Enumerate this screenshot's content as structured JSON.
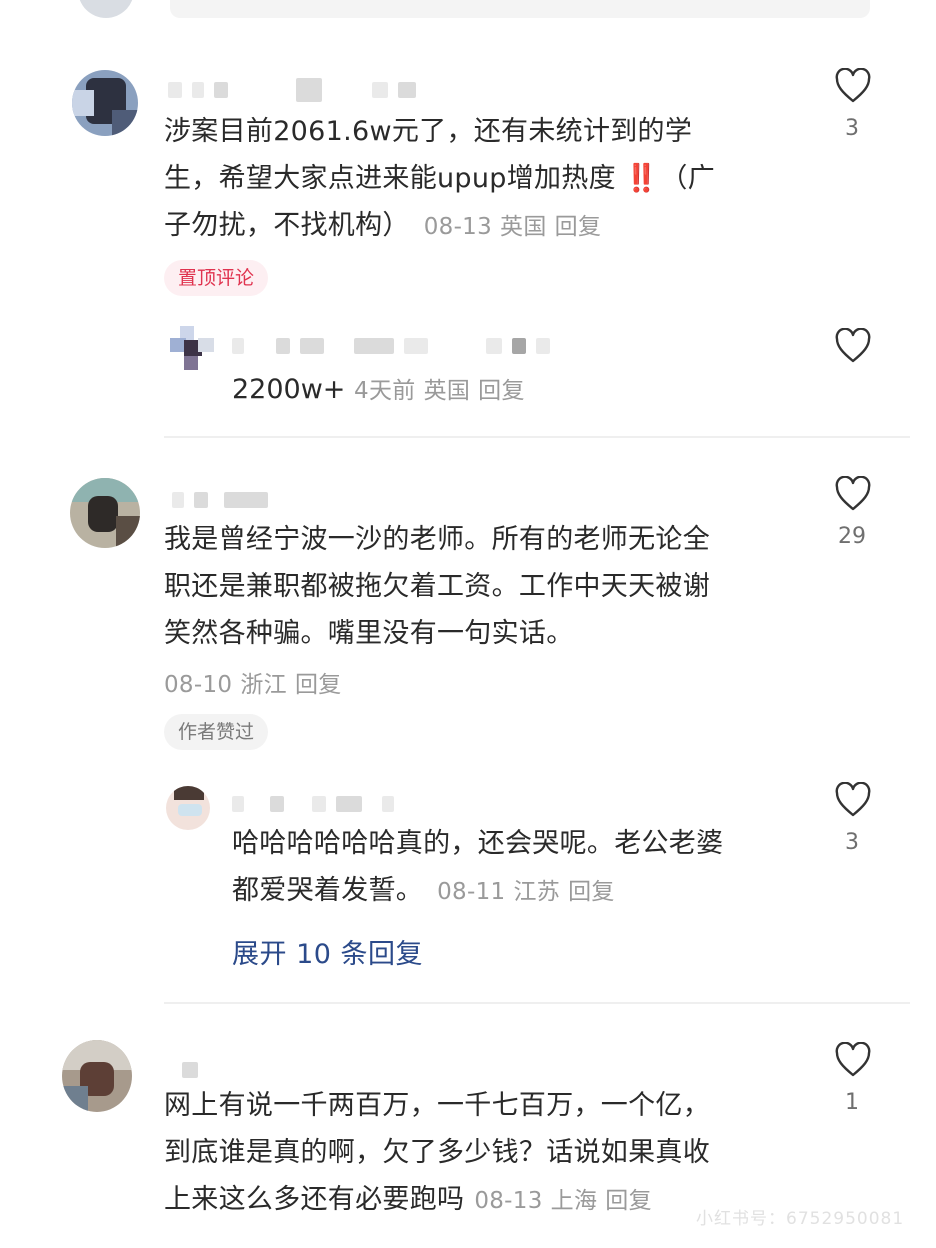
{
  "comments": [
    {
      "text_lines": [
        "涉案目前2061.6w元了，还有未统计到的学",
        "生，希望大家点进来能upup增加热度",
        "子勿扰，不找机构）"
      ],
      "emoji": "‼️",
      "after_emoji": "（广",
      "date": "08-13",
      "location": "英国",
      "reply_label": "回复",
      "badge": "置顶评论",
      "likes": "3",
      "replies": [
        {
          "text": "2200w+",
          "date": "4天前",
          "location": "英国",
          "reply_label": "回复"
        }
      ]
    },
    {
      "text_lines": [
        "我是曾经宁波一沙的老师。所有的老师无论全",
        "职还是兼职都被拖欠着工资。工作中天天被谢",
        "笑然各种骗。嘴里没有一句实话。"
      ],
      "date": "08-10",
      "location": "浙江",
      "reply_label": "回复",
      "badge": "作者赞过",
      "likes": "29",
      "replies": [
        {
          "text_lines": [
            "哈哈哈哈哈哈真的，还会哭呢。老公老婆",
            "都爱哭着发誓。"
          ],
          "date": "08-11",
          "location": "江苏",
          "reply_label": "回复",
          "likes": "3"
        }
      ],
      "expand_label": "展开 10 条回复"
    },
    {
      "text_lines": [
        "网上有说一千两百万，一千七百万，一个亿，",
        "到底谁是真的啊，欠了多少钱？话说如果真收",
        "上来这么多还有必要跑吗"
      ],
      "date": "08-13",
      "location": "上海",
      "reply_label": "回复",
      "likes": "1"
    }
  ],
  "watermark": "小红书号：6752950081",
  "icons": {
    "like": "heart-outline-icon"
  },
  "colors": {
    "pin_badge_text": "#e0334f",
    "expand_link": "#2b4a8a",
    "meta": "#9a9a9a"
  }
}
